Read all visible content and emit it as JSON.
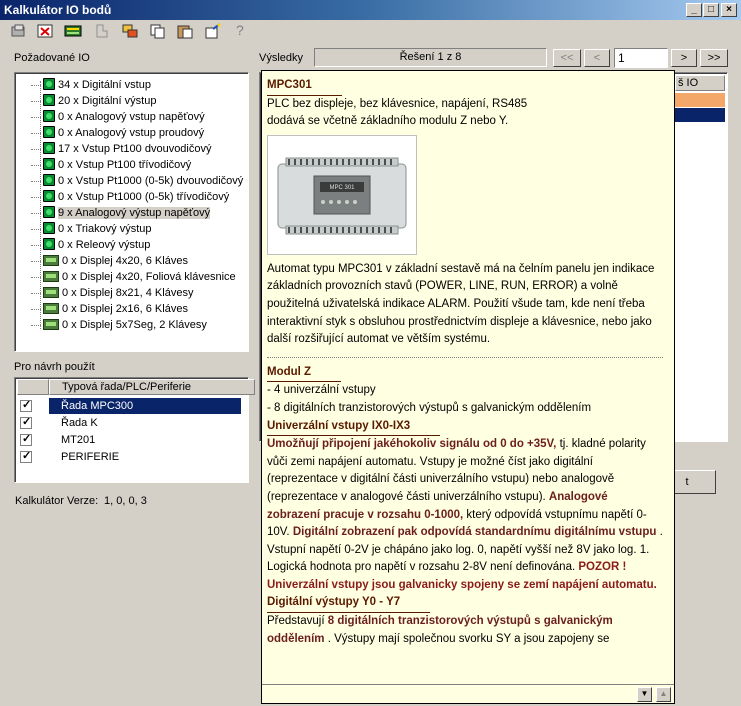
{
  "window": {
    "title": "Kalkulátor IO bodů"
  },
  "toolbar": {
    "icons": [
      "settings-icon",
      "delete-icon",
      "table-icon",
      "disabled-tool-icon",
      "group-icon",
      "copy-icon",
      "paste-icon",
      "wizard-icon",
      "help-icon"
    ],
    "help_label": "?"
  },
  "left": {
    "required_label": "Požadované IO",
    "tree": [
      {
        "text": "34 x Digitální vstup",
        "icon": "green-dot"
      },
      {
        "text": "20 x Digitální výstup",
        "icon": "green-dot"
      },
      {
        "text": "0 x Analogový vstup napěťový",
        "icon": "green-dot"
      },
      {
        "text": "0 x Analogový vstup proudový",
        "icon": "green-dot"
      },
      {
        "text": "17 x Vstup Pt100 dvouvodičový",
        "icon": "green-dot"
      },
      {
        "text": "0 x Vstup Pt100 třívodičový",
        "icon": "green-dot"
      },
      {
        "text": "0 x Vstup Pt1000 (0-5k) dvouvodičový",
        "icon": "green-dot"
      },
      {
        "text": "0 x Vstup Pt1000 (0-5k) třívodičový",
        "icon": "green-dot"
      },
      {
        "text": "9 x Analogový výstup napěťový",
        "icon": "green-dot",
        "selected": true
      },
      {
        "text": "0 x Triakový výstup",
        "icon": "green-dot"
      },
      {
        "text": "0 x Releový výstup",
        "icon": "green-dot"
      },
      {
        "text": "0 x Displej 4x20, 6 Kláves",
        "icon": "display"
      },
      {
        "text": "0 x Displej 4x20, Foliová klávesnice",
        "icon": "display"
      },
      {
        "text": "0 x Displej 8x21,  4 Klávesy",
        "icon": "display"
      },
      {
        "text": "0 x Displej 2x16,  6 Kláves",
        "icon": "display"
      },
      {
        "text": "0 x Displej 5x7Seg, 2 Klávesy",
        "icon": "display"
      }
    ],
    "use_label": "Pro návrh použít",
    "use_header": "Typová řada/PLC/Periferie",
    "use_items": [
      {
        "text": "Řada MPC300",
        "checked": true,
        "selected": true
      },
      {
        "text": "Řada K",
        "checked": true
      },
      {
        "text": "MT201",
        "checked": true
      },
      {
        "text": "PERIFERIE",
        "checked": true
      }
    ],
    "version_label": "Kalkulátor Verze:",
    "version_value": "1, 0, 0, 3"
  },
  "right": {
    "results_label": "Výsledky",
    "solution_text": "Řešení 1 z 8",
    "nav_first": "<<",
    "nav_prev": "<",
    "page_value": "1",
    "nav_next": ">",
    "nav_last": ">>",
    "col_header_partial": "š IO",
    "hidden_button_partial": "t"
  },
  "popup": {
    "title": "MPC301",
    "subtitle": "PLC bez displeje, bez klávesnice, napájení, RS485 dodává se včetně základního modulu Z nebo Y.",
    "image_label": "MPC 301",
    "description": "Automat typu MPC301 v základní sestavě má na čelním panelu jen indikace základních provozních stavů (POWER, LINE, RUN, ERROR) a volně použitelná uživatelská indikace ALARM. Použití všude tam, kde není třeba interaktivní styk s obsluhou prostřednictvím displeje a klávesnice, nebo jako další rozšiřující automat ve větším systému.",
    "module_title": "Modul Z",
    "module_items": [
      "- 4 univerzální vstupy",
      "- 8 digitálních tranzistorových výstupů s galvanickým oddělením"
    ],
    "uni_title": "Univerzální vstupy  IX0-IX3",
    "uni_p1_bold": "Umožňují připojení jakéhokoliv signálu od 0 do +35V,",
    "uni_p1_rest": " tj. kladné polarity vůči zemi napájení automatu. Vstupy je možné číst jako digitální (reprezentace v digitální části univerzálního vstupu) nebo analogově (reprezentace v analogové části univerzálního vstupu).",
    "uni_p2_bold": "Analogové zobrazení pracuje v rozsahu 0-1000,",
    "uni_p2_rest": " který odpovídá vstupnímu napětí 0-10V.",
    "uni_p3_bold": "Digitální zobrazení pak odpovídá standardnímu digitálnímu vstupu",
    "uni_p3_rest": " . Vstupní napětí 0-2V je chápáno jako log. 0, napětí vyšší než 8V jako log. 1. Logická hodnota pro napětí v rozsahu 2-8V není definována.",
    "warning": "POZOR ! Univerzální vstupy jsou galvanicky spojeny se zemí napájení automatu.",
    "dig_title": "Digitální výstupy Y0 - Y7",
    "dig_p_start": "Představují ",
    "dig_p_bold": "8 digitálních tranzistorových výstupů s galvanickým oddělením",
    "dig_p_rest": " . Výstupy mají společnou svorku SY a jsou zapojeny se"
  },
  "colors": {
    "accent": "#0a246a",
    "popup_bg": "#ffffe1",
    "header_text": "#5a1a00",
    "emphasis": "#8b1a1a"
  }
}
